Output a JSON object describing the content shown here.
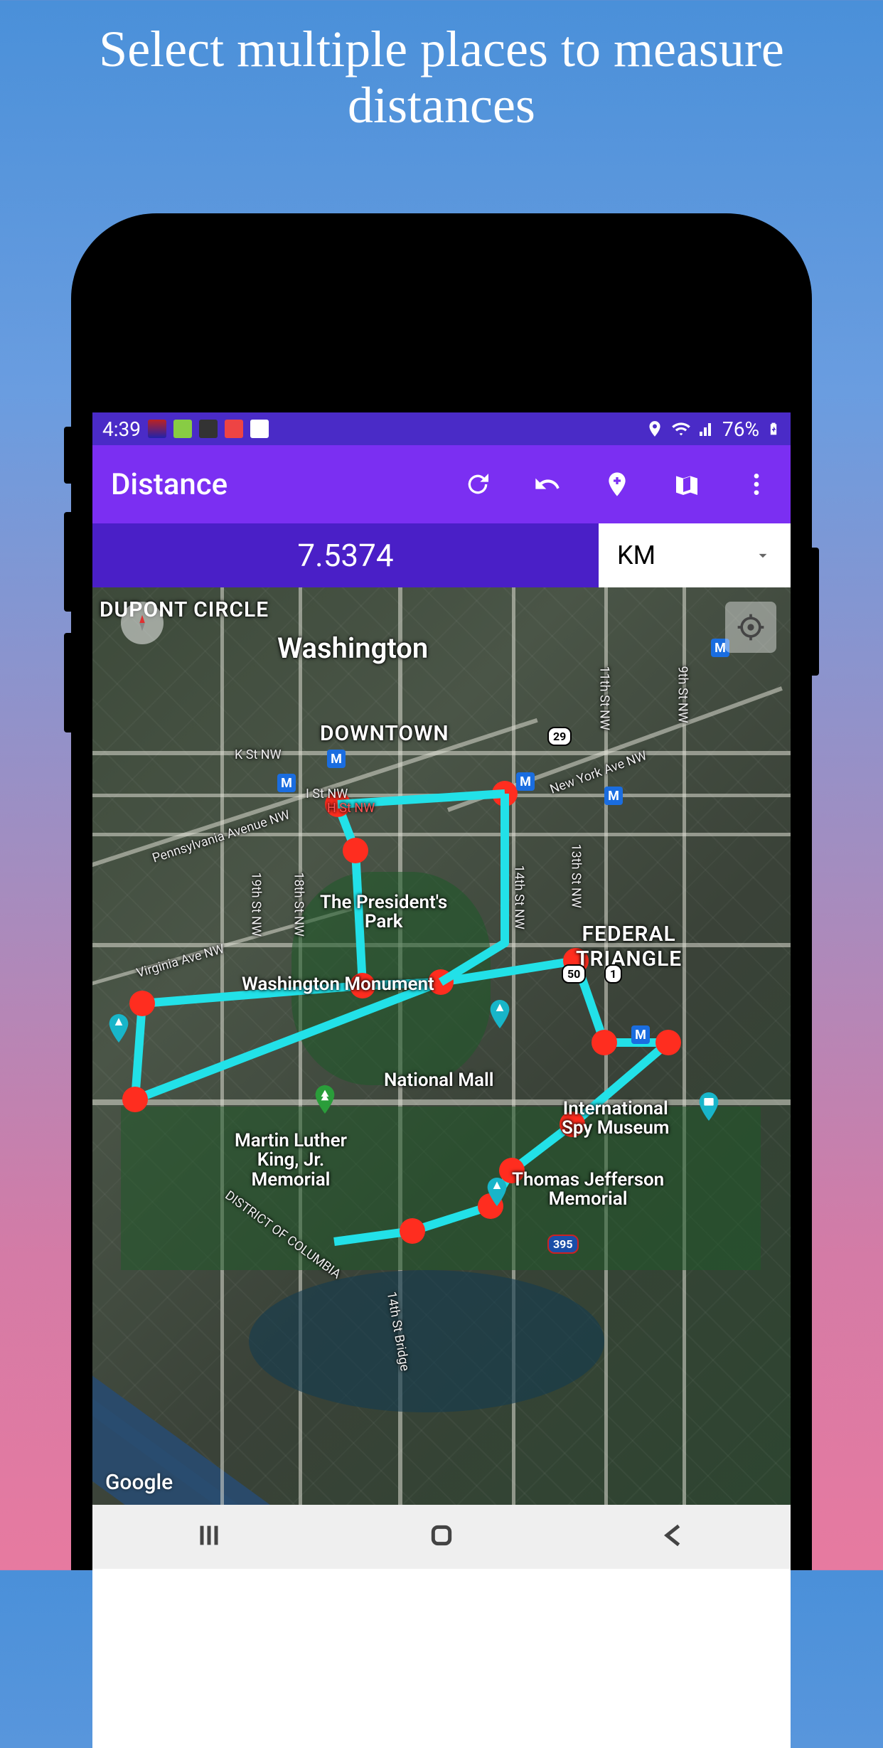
{
  "promo": {
    "title": "Select multiple places to measure distances"
  },
  "status": {
    "time": "4:39",
    "battery": "76%"
  },
  "appbar": {
    "title": "Distance"
  },
  "measure": {
    "value": "7.5374",
    "unit": "KM"
  },
  "map": {
    "city": "Washington",
    "areas": {
      "dupont": "DUPONT CIRCLE",
      "downtown": "DOWNTOWN",
      "federal": "FEDERAL TRIANGLE",
      "district": "DISTRICT OF COLUMBIA"
    },
    "pois": {
      "presidents_park": "The President's\nPark",
      "wash_monument": "Washington Monument",
      "national_mall": "National Mall",
      "spy_museum": "International\nSpy Museum",
      "jefferson": "Thomas Jefferson\nMemorial",
      "mlk": "Martin Luther\nKing, Jr.\nMemorial"
    },
    "streets": {
      "k_st": "K St NW",
      "i_st": "I St NW",
      "h_st": "H St NW",
      "penn_ave": "Pennsylvania Avenue NW",
      "virginia": "Virginia Ave NW",
      "ny_ave": "New York Ave NW",
      "ninth": "9th St NW",
      "eleventh": "11th St NW",
      "thirteenth": "13th St NW",
      "fourteenth": "14th St NW",
      "eighteenth": "18th St NW",
      "nineteenth": "19th St NW",
      "bridge": "14th St Bridge"
    },
    "shields": {
      "us29": "29",
      "us50": "50",
      "us1": "1",
      "i395": "395"
    },
    "metro": "M",
    "attribution": "Google"
  }
}
